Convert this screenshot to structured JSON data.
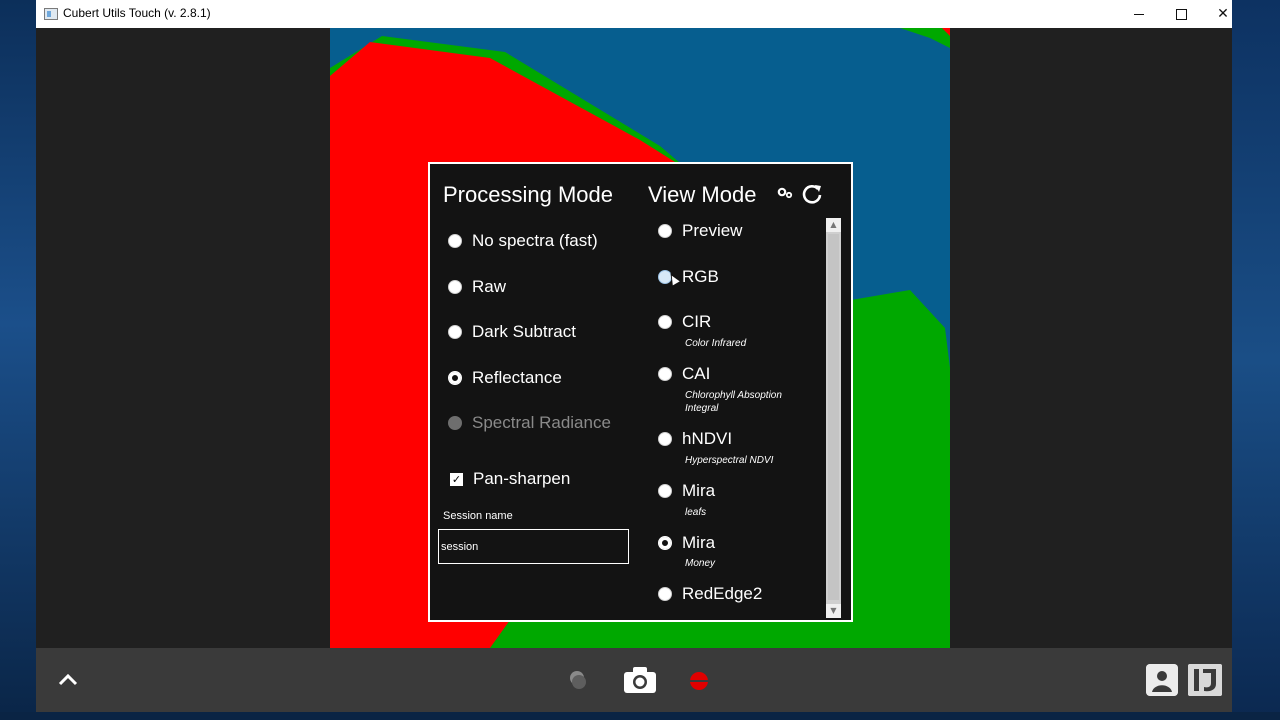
{
  "window": {
    "title": "Cubert Utils Touch (v. 2.8.1)",
    "controls": {
      "minimize": "minimize",
      "maximize": "maximize",
      "close": "✕"
    }
  },
  "processing_mode": {
    "heading": "Processing Mode",
    "options": [
      {
        "label": "No spectra (fast)",
        "state": "unselected"
      },
      {
        "label": "Raw",
        "state": "unselected"
      },
      {
        "label": "Dark Subtract",
        "state": "unselected"
      },
      {
        "label": "Reflectance",
        "state": "selected"
      },
      {
        "label": "Spectral Radiance",
        "state": "disabled"
      }
    ],
    "pan_sharpen": {
      "label": "Pan-sharpen",
      "checked": true,
      "mark": "✓"
    },
    "session": {
      "label": "Session name",
      "value": "session"
    }
  },
  "view_mode": {
    "heading": "View Mode",
    "icons": [
      "gear-icon",
      "refresh-icon"
    ],
    "options": [
      {
        "label": "Preview",
        "sub": "",
        "state": "unselected"
      },
      {
        "label": "RGB",
        "sub": "",
        "state": "hover"
      },
      {
        "label": "CIR",
        "sub": "Color Infrared",
        "state": "unselected"
      },
      {
        "label": "CAI",
        "sub": "Chlorophyll Absoption Integral",
        "state": "unselected"
      },
      {
        "label": "hNDVI",
        "sub": "Hyperspectral NDVI",
        "state": "unselected"
      },
      {
        "label": "Mira",
        "sub": "leafs",
        "state": "unselected"
      },
      {
        "label": "Mira",
        "sub": "Money",
        "state": "selected"
      },
      {
        "label": "RedEdge2",
        "sub": "",
        "state": "unselected"
      }
    ]
  },
  "toolbar": {
    "icons": [
      "chevron-up-icon",
      "capture-dot-icon",
      "camera-icon",
      "record-icon",
      "gallery-icon",
      "imagej-icon"
    ]
  },
  "colors": {
    "image_red": "#ff0000",
    "image_green": "#00a800",
    "image_blue": "#065e8f",
    "panel_bg": "#131313",
    "toolbar_bg": "#3a3a3a",
    "record_red": "#e00000"
  }
}
